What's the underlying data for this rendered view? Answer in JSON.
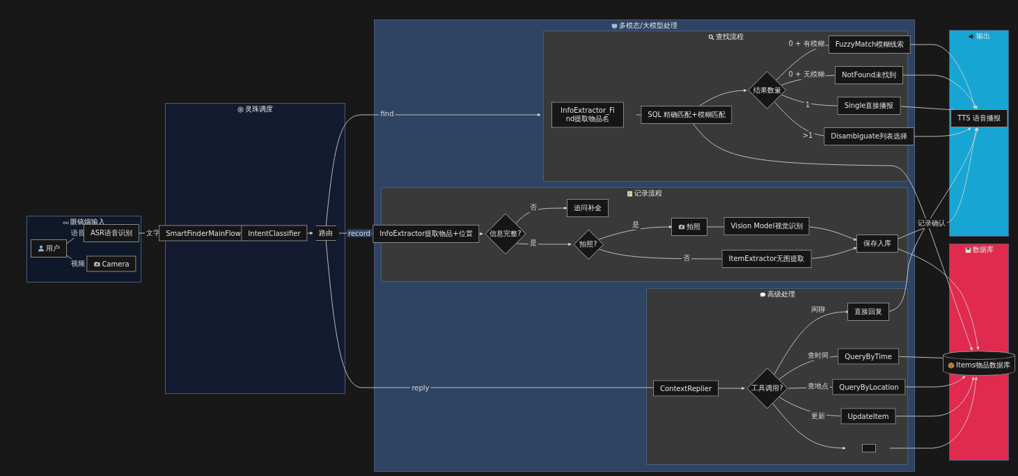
{
  "diagram": {
    "clusters": [
      {
        "title": "眼镜端输入",
        "color": "#0e1828",
        "nodes": [
          {
            "label": "用户",
            "kind": "rect"
          },
          {
            "label": "ASR语音识别",
            "kind": "rect"
          },
          {
            "label": "Camera",
            "kind": "rect"
          }
        ]
      },
      {
        "title": "灵珠调度",
        "color": "#141b30",
        "nodes": [
          {
            "label": "SmartFinderMainFlow",
            "kind": "rect"
          },
          {
            "label": "IntentClassifier",
            "kind": "rect"
          },
          {
            "label": "路由",
            "kind": "hexagon"
          }
        ]
      },
      {
        "title": "多模态/大模型处理",
        "color": "#2f4363",
        "subclusters": [
          {
            "title": "查找流程",
            "color": "#393939",
            "nodes": [
              {
                "label": "InfoExtractor_Find提取物品名",
                "kind": "rect"
              },
              {
                "label": "SQL 精确匹配+模糊匹配",
                "kind": "rect"
              },
              {
                "label": "结果数量",
                "kind": "diamond"
              },
              {
                "label": "FuzzyMatch模糊线索",
                "kind": "rect"
              },
              {
                "label": "NotFound未找到",
                "kind": "rect"
              },
              {
                "label": "Single直接播报",
                "kind": "rect"
              },
              {
                "label": "Disambiguate列表选择",
                "kind": "rect"
              }
            ]
          },
          {
            "title": "记录流程",
            "color": "#393939",
            "nodes": [
              {
                "label": "InfoExtractor提取物品+位置",
                "kind": "rect"
              },
              {
                "label": "信息完整?",
                "kind": "diamond"
              },
              {
                "label": "追问补全",
                "kind": "rect"
              },
              {
                "label": "拍照?",
                "kind": "diamond"
              },
              {
                "label": "拍照",
                "kind": "rect"
              },
              {
                "label": "Vision Model视觉识别",
                "kind": "rect"
              },
              {
                "label": "ItemExtractor无图提取",
                "kind": "rect"
              },
              {
                "label": "保存入库",
                "kind": "rect"
              }
            ]
          },
          {
            "title": "高级处理",
            "color": "#393939",
            "nodes": [
              {
                "label": "ContextReplier",
                "kind": "rect"
              },
              {
                "label": "工具调用?",
                "kind": "diamond"
              },
              {
                "label": "直接回复",
                "kind": "rect"
              },
              {
                "label": "QueryByTime",
                "kind": "rect"
              },
              {
                "label": "QueryByLocation",
                "kind": "rect"
              },
              {
                "label": "UpdateItem",
                "kind": "rect"
              },
              {
                "kind": "rect"
              }
            ]
          }
        ]
      },
      {
        "title": "输出",
        "color": "#17a6d3",
        "nodes": [
          {
            "label": "TTS 语音播报",
            "kind": "rect"
          }
        ]
      },
      {
        "title": "数据库",
        "color": "#e02a4e",
        "nodes": [
          {
            "label": "Items物品数据库",
            "kind": "cylinder"
          }
        ]
      }
    ],
    "edge_labels": [
      "语音",
      "视频",
      "文字",
      "find",
      "record",
      "reply",
      "0 + 有模糊",
      "0 + 无模糊",
      "1",
      ">1",
      "否",
      "是",
      "是",
      "否",
      "闲聊",
      "查时间",
      "查地点",
      "更新",
      "记录确认"
    ]
  }
}
